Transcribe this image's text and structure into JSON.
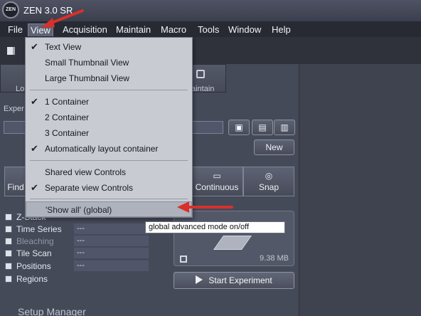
{
  "window": {
    "title": "ZEN 3.0 SR",
    "logo_text": "ZEN"
  },
  "menubar": {
    "items": [
      "File",
      "View",
      "Acquisition",
      "Maintain",
      "Macro",
      "Tools",
      "Window",
      "Help"
    ],
    "active": "View"
  },
  "tabs": [
    {
      "label": "Lo"
    },
    {
      "label": "aintain"
    }
  ],
  "experiment": {
    "label": "Exper",
    "value": "",
    "new_button": "New",
    "buttons": [
      "open-folder-icon",
      "save-icon",
      "delete-icon"
    ]
  },
  "acquisition_buttons": [
    {
      "label": "Find",
      "icon": ""
    },
    {
      "label": "Continuous",
      "icon": "video-icon"
    },
    {
      "label": "Snap",
      "icon": "camera-icon"
    }
  ],
  "options": [
    {
      "label": "Z-Stack",
      "value": "",
      "checked": false,
      "enabled": true
    },
    {
      "label": "Time Series",
      "value": "---",
      "checked": false,
      "enabled": true
    },
    {
      "label": "Bleaching",
      "value": "---",
      "checked": false,
      "enabled": false
    },
    {
      "label": "Tile Scan",
      "value": "---",
      "checked": false,
      "enabled": true
    },
    {
      "label": "Positions",
      "value": "---",
      "checked": false,
      "enabled": true
    },
    {
      "label": "Regions",
      "value": "",
      "checked": false,
      "enabled": true
    }
  ],
  "preview": {
    "size": "9.38 MB"
  },
  "start_button": "Start Experiment",
  "setup_manager": "Setup Manager",
  "view_menu": {
    "items": [
      {
        "label": "Text View",
        "checked": true
      },
      {
        "label": "Small Thumbnail View",
        "checked": false
      },
      {
        "label": "Large Thumbnail View",
        "checked": false
      },
      {
        "label": "1 Container",
        "checked": true
      },
      {
        "label": "2 Container",
        "checked": false
      },
      {
        "label": "3 Container",
        "checked": false
      },
      {
        "label": "Automatically layout container",
        "checked": true
      },
      {
        "label": "Shared view Controls",
        "checked": false
      },
      {
        "label": "Separate view Controls",
        "checked": true
      },
      {
        "label": "'Show all' (global)",
        "checked": false
      }
    ]
  },
  "tooltip": "global advanced mode on/off",
  "colors": {
    "accent": "#d9302a",
    "background": "#3d4150"
  }
}
